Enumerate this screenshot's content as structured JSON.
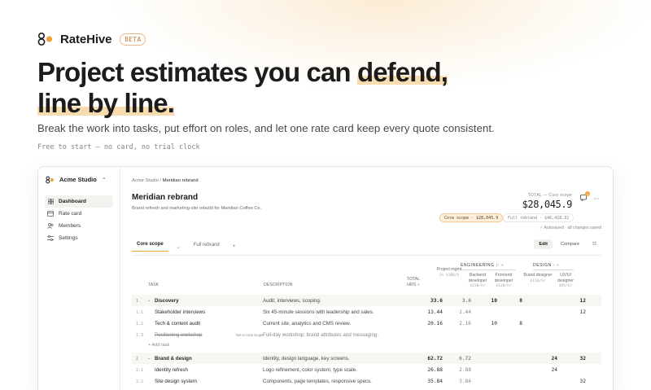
{
  "brand": {
    "name": "RateHive",
    "badge": "BETA"
  },
  "hero": {
    "title_line1_plain": "Project estimates you can ",
    "title_line1_highlight": "defend,",
    "title_line2_highlight": "line by line.",
    "subtitle": "Break the work into tasks, put effort on roles, and let one rate card keep every quote consistent.",
    "note": "Free to start — no card, no trial clock"
  },
  "colors": {
    "accent": "#e8a042",
    "highlight": "#f6dcae"
  },
  "app": {
    "workspace": "Acme Studio",
    "nav": [
      {
        "label": "Dashboard",
        "icon": "grid-icon",
        "active": true
      },
      {
        "label": "Rate card",
        "icon": "card-icon",
        "active": false
      },
      {
        "label": "Members",
        "icon": "users-icon",
        "active": false
      },
      {
        "label": "Settings",
        "icon": "sliders-icon",
        "active": false
      }
    ],
    "breadcrumb": {
      "parent": "Acme Studio",
      "sep": "/",
      "current": "Meridian rebrand"
    },
    "project": {
      "title": "Meridian rebrand",
      "description": "Brand refresh and marketing-site rebuild for Meridian Coffee Co."
    },
    "total": {
      "label": "TOTAL — Core scope",
      "value": "$28,045.9"
    },
    "notification_count": "1",
    "scopes": {
      "core": "Core scope · $28,045.9",
      "full": "Full rebrand · $46,418.32"
    },
    "autosave": "Autosaved · all changes saved",
    "tabs": [
      "Core scope",
      "Full rebrand"
    ],
    "tab_add": "+",
    "mode": {
      "edit": "Edit",
      "compare": "Compare"
    },
    "table": {
      "headers": {
        "task": "TASK",
        "description": "DESCRIPTION",
        "total_hrs": "TOTAL HRS",
        "pm": "Project mgmt",
        "pm_rate": "1%  $100/h",
        "engineering": "ENGINEERING",
        "design": "DESIGN",
        "backend": "Backend developer",
        "backend_rate": "$150/hr",
        "frontend": "Frontend developer",
        "frontend_rate": "$120/hr",
        "brand": "Brand designer",
        "brand_rate": "$110/hr",
        "ux": "UX/UI designer",
        "ux_rate": "$95/hr"
      },
      "rows": [
        {
          "num": "1",
          "group": true,
          "task": "Discovery",
          "desc": "Audit, interviews, scoping.",
          "total": "33.6",
          "pm": "3.6",
          "be": "10",
          "fe": "8",
          "bd": "",
          "ux": "12"
        },
        {
          "num": "1.1",
          "group": false,
          "task": "Stakeholder interviews",
          "desc": "Six 45-minute sessions with leadership and sales.",
          "total": "13.44",
          "pm": "1.44",
          "be": "",
          "fe": "",
          "bd": "",
          "ux": "12"
        },
        {
          "num": "1.2",
          "group": false,
          "task": "Tech & content audit",
          "desc": "Current site, analytics and CMS review.",
          "total": "20.16",
          "pm": "2.16",
          "be": "10",
          "fe": "8",
          "bd": "",
          "ux": ""
        },
        {
          "num": "1.3",
          "group": false,
          "off": true,
          "task": "Positioning workshop",
          "notin": "Not in Core scope",
          "desc": "Full-day workshop: brand attributes and messaging.",
          "total": "",
          "pm": "",
          "be": "",
          "fe": "",
          "bd": "",
          "ux": ""
        },
        {
          "num": "2",
          "group": true,
          "task": "Brand & design",
          "desc": "Identity, design language, key screens.",
          "total": "62.72",
          "pm": "6.72",
          "be": "",
          "fe": "",
          "bd": "24",
          "ux": "32"
        },
        {
          "num": "2.1",
          "group": false,
          "task": "Identity refresh",
          "desc": "Logo refinement, color system, type scale.",
          "total": "26.88",
          "pm": "2.88",
          "be": "",
          "fe": "",
          "bd": "24",
          "ux": ""
        },
        {
          "num": "2.2",
          "group": false,
          "task": "Site design system",
          "desc": "Components, page templates, responsive specs.",
          "total": "35.84",
          "pm": "3.84",
          "be": "",
          "fe": "",
          "bd": "",
          "ux": "32"
        }
      ],
      "add_task": "+ Add task"
    }
  }
}
